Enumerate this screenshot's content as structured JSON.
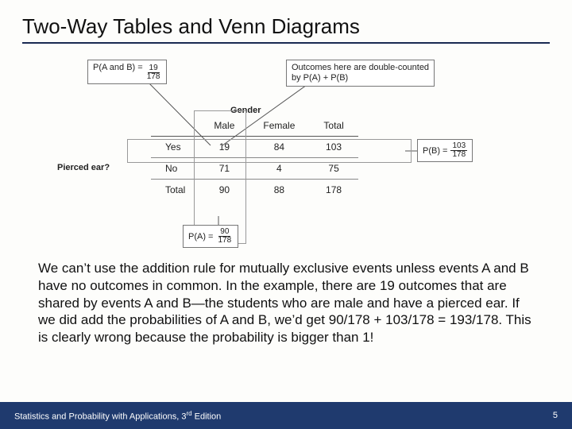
{
  "title": "Two-Way Tables and Venn Diagrams",
  "callouts": {
    "pab_label": "P(A and B) =",
    "pab_num": "19",
    "pab_den": "178",
    "double": "Outcomes here are double-counted\nby P(A) + P(B)"
  },
  "gender_label": "Gender",
  "pierced_label": "Pierced ear?",
  "table": {
    "head_blank": "",
    "head_male": "Male",
    "head_female": "Female",
    "head_total": "Total",
    "rows": [
      {
        "label": "Yes",
        "male": "19",
        "female": "84",
        "total": "103"
      },
      {
        "label": "No",
        "male": "71",
        "female": "4",
        "total": "75"
      },
      {
        "label": "Total",
        "male": "90",
        "female": "88",
        "total": "178"
      }
    ]
  },
  "pa_label": "P(A) =",
  "pa_num": "90",
  "pa_den": "178",
  "pb_label": "P(B) =",
  "pb_num": "103",
  "pb_den": "178",
  "body": "We can’t use the addition rule for mutually exclusive events unless events A and B have no outcomes in common. In the example, there are 19 outcomes that are shared by events A and B—the students who are male and have a pierced ear. If we did add the probabilities of A and B, we’d get 90/178 + 103/178 = 193/178. This is clearly wrong because the probability is bigger than 1!",
  "footer": {
    "left_a": "Statistics and Probability with Applications, 3",
    "left_sup": "rd",
    "left_b": " Edition",
    "page": "5"
  },
  "chart_data": {
    "type": "table",
    "title": "Two-way table of gender vs pierced ear",
    "row_variable": "Pierced ear?",
    "col_variable": "Gender",
    "columns": [
      "Male",
      "Female",
      "Total"
    ],
    "rows": [
      {
        "label": "Yes",
        "values": [
          19,
          84,
          103
        ]
      },
      {
        "label": "No",
        "values": [
          71,
          4,
          75
        ]
      },
      {
        "label": "Total",
        "values": [
          90,
          88,
          178
        ]
      }
    ],
    "probabilities": {
      "P(A)": "90/178",
      "P(B)": "103/178",
      "P(A and B)": "19/178"
    },
    "annotations": [
      "Outcomes here are double-counted by P(A) + P(B)"
    ]
  }
}
